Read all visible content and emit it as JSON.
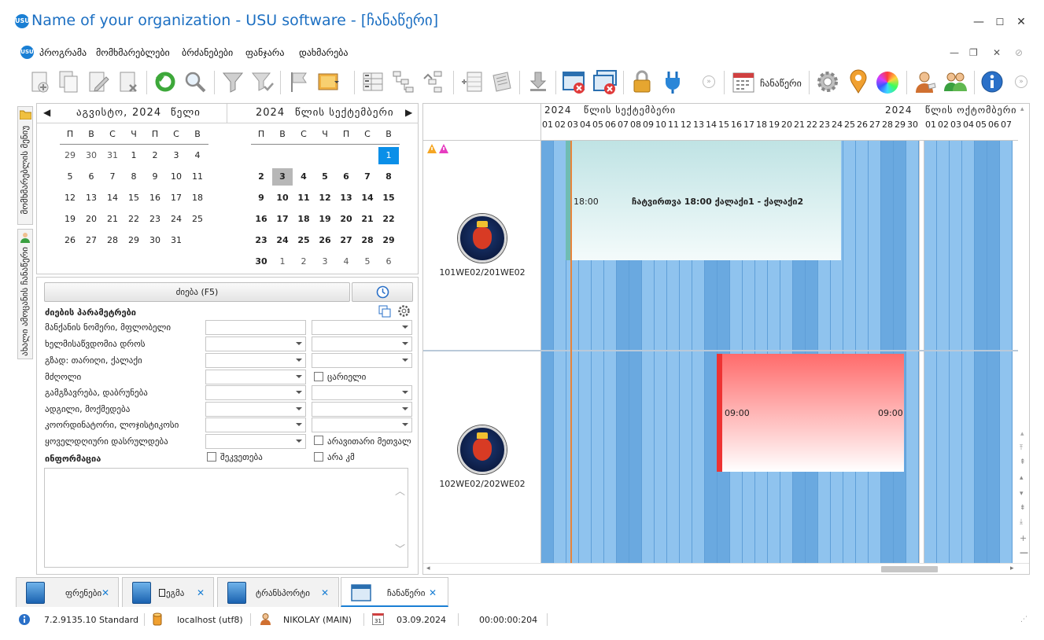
{
  "window": {
    "app_logo": "USU",
    "title": "Name of your organization - USU software - [ჩანაწერი]",
    "controls": [
      "—",
      "☐",
      "✕"
    ]
  },
  "menu": {
    "logo": "USU",
    "items": [
      "პროგრამა",
      "მომხმარებლები",
      "ბრძანებები",
      "ფანჯარა",
      "დახმარება"
    ],
    "mdi_controls": [
      "—",
      "❐",
      "✕",
      "⊘"
    ]
  },
  "toolbar": {
    "record_label": "ჩანაწერი",
    "icons": [
      "add-icon",
      "copy-icon",
      "edit-icon",
      "delete-icon",
      "refresh-icon",
      "search-icon",
      "filter-icon",
      "filter-clear-icon",
      "flag-icon",
      "image-icon",
      "group-icon",
      "tree-expand-icon",
      "tree-collapse-icon",
      "columns-icon",
      "notes-icon",
      "export-icon",
      "close-window-icon",
      "close-all-icon",
      "lock-icon",
      "plug-icon",
      "calendar-icon",
      "settings-icon",
      "map-pin-icon",
      "color-wheel-icon",
      "user-icon",
      "users-icon",
      "info-icon"
    ]
  },
  "left_strip": {
    "tab1": "მომხმარებლის მენიუ",
    "tab2": "ახალი ამოცანის ჩანაწერი"
  },
  "calendar": {
    "left_header_month": "აგვისტო,",
    "left_header_year": "2024",
    "left_header_suffix": "წელი",
    "right_header_year": "2024",
    "right_header_rest": "წლის სექტემბერი",
    "dow": [
      "П",
      "В",
      "С",
      "Ч",
      "П",
      "С",
      "В"
    ],
    "august_rows": [
      [
        "29",
        "30",
        "31",
        "1",
        "2",
        "3",
        "4"
      ],
      [
        "5",
        "6",
        "7",
        "8",
        "9",
        "10",
        "11"
      ],
      [
        "12",
        "13",
        "14",
        "15",
        "16",
        "17",
        "18"
      ],
      [
        "19",
        "20",
        "21",
        "22",
        "23",
        "24",
        "25"
      ],
      [
        "26",
        "27",
        "28",
        "29",
        "30",
        "31",
        ""
      ]
    ],
    "september_rows": [
      [
        "",
        "",
        "",
        "",
        "",
        "",
        "1"
      ],
      [
        "2",
        "3",
        "4",
        "5",
        "6",
        "7",
        "8"
      ],
      [
        "9",
        "10",
        "11",
        "12",
        "13",
        "14",
        "15"
      ],
      [
        "16",
        "17",
        "18",
        "19",
        "20",
        "21",
        "22"
      ],
      [
        "23",
        "24",
        "25",
        "26",
        "27",
        "28",
        "29"
      ],
      [
        "30",
        "1",
        "2",
        "3",
        "4",
        "5",
        "6"
      ]
    ],
    "selected_day": "1",
    "today": "3"
  },
  "search": {
    "button_label": "ძიება (F5)",
    "params_title": "ძიების პარამეტრები",
    "labels": [
      "მანქანის ნომერი, მფლობელი",
      "ხელმისაწვდომია დროს",
      "გზად: თარიღი, ქალაქი",
      "მძღოლი",
      "გამგზავრება, დაბრუნება",
      "ადგილი, მოქმედება",
      "კოორდინატორი, ლოჯისტიკოსი",
      "ყოველდღიური დასრულდება"
    ],
    "chk_empty": "ცარიელი",
    "chk_no_monitor": "არავითარი მეთვალ",
    "chk_order": "შეკვეთება",
    "chk_no_km": "არა კმ",
    "info_label": "ინფორმაცია"
  },
  "schedule": {
    "month1_year": "2024",
    "month1_rest": "წლის სექტემბერი",
    "month2_year": "2024",
    "month2_rest": "წლის ოქტომბერი",
    "days_sep": [
      "01",
      "02",
      "03",
      "04",
      "05",
      "06",
      "07",
      "08",
      "09",
      "10",
      "11",
      "12",
      "13",
      "14",
      "15",
      "16",
      "17",
      "18",
      "19",
      "20",
      "21",
      "22",
      "23",
      "24",
      "25",
      "26",
      "27",
      "28",
      "29",
      "30"
    ],
    "days_oct": [
      "01",
      "02",
      "03",
      "04",
      "05",
      "06",
      "07"
    ],
    "vehicles": [
      {
        "name": "101WE02/201WE02",
        "logo": "scania-griffin-icon"
      },
      {
        "name": "102WE02/202WE02",
        "logo": "scania-griffin-icon"
      }
    ],
    "event1_time": "18:00",
    "event1_text": "ჩატვირთვა 18:00 ქალაქი1 - ქალაქი2",
    "event2_time_start": "09:00",
    "event2_time_end": "09:00",
    "colors": {
      "event1": "#d9f0ee",
      "event2": "#ff7070",
      "day_col": "#8fc3ee",
      "weekend_col": "#6aa9e0",
      "now_line": "#e8843a"
    }
  },
  "tabs": [
    {
      "label": "ფრენები"
    },
    {
      "label": "ეგმა"
    },
    {
      "label": "ტრანსპორტი"
    },
    {
      "label": "ჩანაწერი"
    }
  ],
  "status": {
    "version": "7.2.9135.10 Standard",
    "db": "localhost (utf8)",
    "user": "NIKOLAY (MAIN)",
    "date": "03.09.2024",
    "timer": "00:00:00:204",
    "date_icon_text": "31"
  }
}
